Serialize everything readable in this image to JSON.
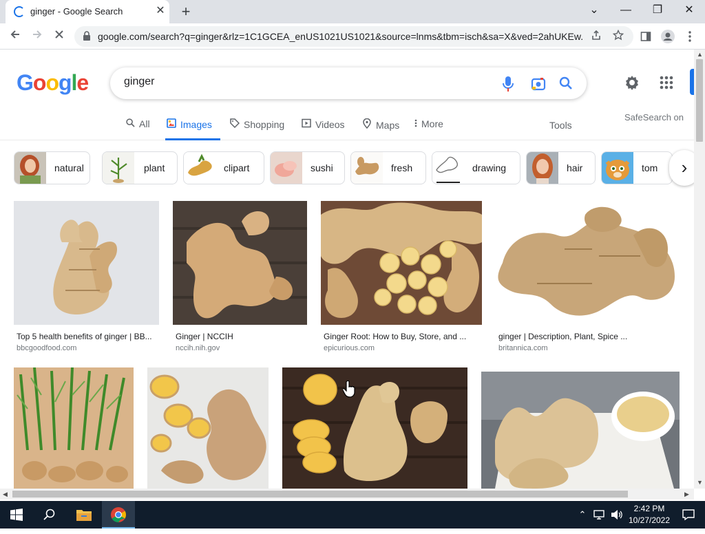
{
  "browser": {
    "tab_title": "ginger - Google Search",
    "tab_close": "✕",
    "new_tab": "+",
    "url": "google.com/search?q=ginger&rlz=1C1GCEA_enUS1021US1021&source=lnms&tbm=isch&sa=X&ved=2ahUKEw...",
    "window_buttons": {
      "dropdown": "⌄",
      "minimize": "—",
      "restore": "❐",
      "close": "✕"
    }
  },
  "google": {
    "logo_letters": [
      {
        "ch": "G",
        "color": "#4285f4"
      },
      {
        "ch": "o",
        "color": "#ea4335"
      },
      {
        "ch": "o",
        "color": "#fbbc05"
      },
      {
        "ch": "g",
        "color": "#4285f4"
      },
      {
        "ch": "l",
        "color": "#34a853"
      },
      {
        "ch": "e",
        "color": "#ea4335"
      }
    ],
    "query": "ginger",
    "tabs": [
      {
        "label": "All",
        "icon": "search-icon",
        "active": false
      },
      {
        "label": "Images",
        "icon": "image-icon",
        "active": true
      },
      {
        "label": "Shopping",
        "icon": "tag-icon",
        "active": false
      },
      {
        "label": "Videos",
        "icon": "play-icon",
        "active": false
      },
      {
        "label": "Maps",
        "icon": "pin-icon",
        "active": false
      },
      {
        "label": "More",
        "icon": "more-dots-icon",
        "active": false
      }
    ],
    "tools_label": "Tools",
    "safesearch_label": "SafeSearch on",
    "accent": "#1a73e8"
  },
  "chips": [
    {
      "label": "natural",
      "thumb": "woman-red-hair"
    },
    {
      "label": "plant",
      "thumb": "ginger-plant"
    },
    {
      "label": "clipart",
      "thumb": "ginger-clipart"
    },
    {
      "label": "sushi",
      "thumb": "pickled-ginger"
    },
    {
      "label": "fresh",
      "thumb": "ginger-root"
    },
    {
      "label": "drawing",
      "thumb": "ginger-drawing"
    },
    {
      "label": "hair",
      "thumb": "woman-red-hair"
    },
    {
      "label": "tom",
      "thumb": "talking-tom-cat"
    }
  ],
  "results": [
    {
      "caption": "Top 5 health benefits of ginger | BB...",
      "source": "bbcgoodfood.com"
    },
    {
      "caption": "Ginger | NCCIH",
      "source": "nccih.nih.gov"
    },
    {
      "caption": "Ginger Root: How to Buy, Store, and ...",
      "source": "epicurious.com"
    },
    {
      "caption": "ginger | Description, Plant, Spice ...",
      "source": "britannica.com"
    },
    {
      "caption": "",
      "source": ""
    },
    {
      "caption": "",
      "source": ""
    },
    {
      "caption": "",
      "source": ""
    },
    {
      "caption": "",
      "source": ""
    }
  ],
  "taskbar": {
    "time": "2:42 PM",
    "date": "10/27/2022"
  }
}
